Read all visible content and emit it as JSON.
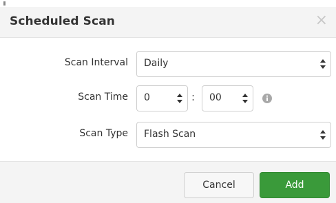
{
  "dialog": {
    "title": "Scheduled Scan",
    "close_symbol": "×"
  },
  "form": {
    "interval": {
      "label": "Scan Interval",
      "value": "Daily"
    },
    "time": {
      "label": "Scan Time",
      "hour": "0",
      "separator": ":",
      "minute": "00",
      "info_icon": "info-icon"
    },
    "type": {
      "label": "Scan Type",
      "value": "Flash Scan"
    }
  },
  "footer": {
    "cancel_label": "Cancel",
    "add_label": "Add"
  },
  "colors": {
    "primary": "#3a9a3a",
    "header_bg": "#f4f4f4"
  }
}
